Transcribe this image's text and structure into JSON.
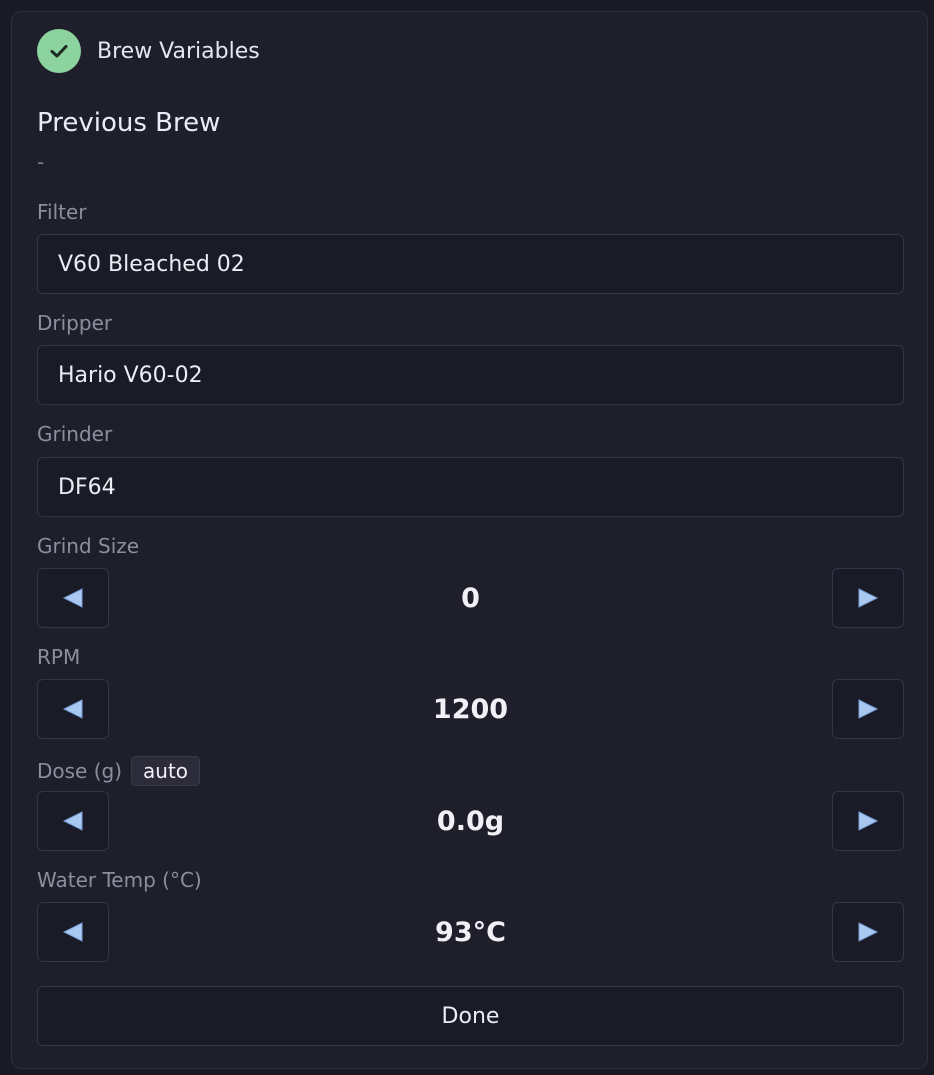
{
  "header": {
    "title": "Brew Variables",
    "status_color": "#8dd3a0"
  },
  "previous_brew": {
    "title": "Previous Brew",
    "value": "-"
  },
  "fields": {
    "filter": {
      "label": "Filter",
      "value": "V60 Bleached 02"
    },
    "dripper": {
      "label": "Dripper",
      "value": "Hario V60-02"
    },
    "grinder": {
      "label": "Grinder",
      "value": "DF64"
    }
  },
  "steppers": {
    "grind_size": {
      "label": "Grind Size",
      "value": "0"
    },
    "rpm": {
      "label": "RPM",
      "value": "1200"
    },
    "dose": {
      "label": "Dose (g)",
      "badge": "auto",
      "value": "0.0g"
    },
    "water_temp": {
      "label": "Water Temp (°C)",
      "value": "93°C"
    }
  },
  "icons": {
    "decrement": "left-triangle-icon",
    "increment": "right-triangle-icon",
    "check": "check-icon",
    "arrow_color": "#a9c8f2"
  },
  "actions": {
    "done_label": "Done"
  }
}
